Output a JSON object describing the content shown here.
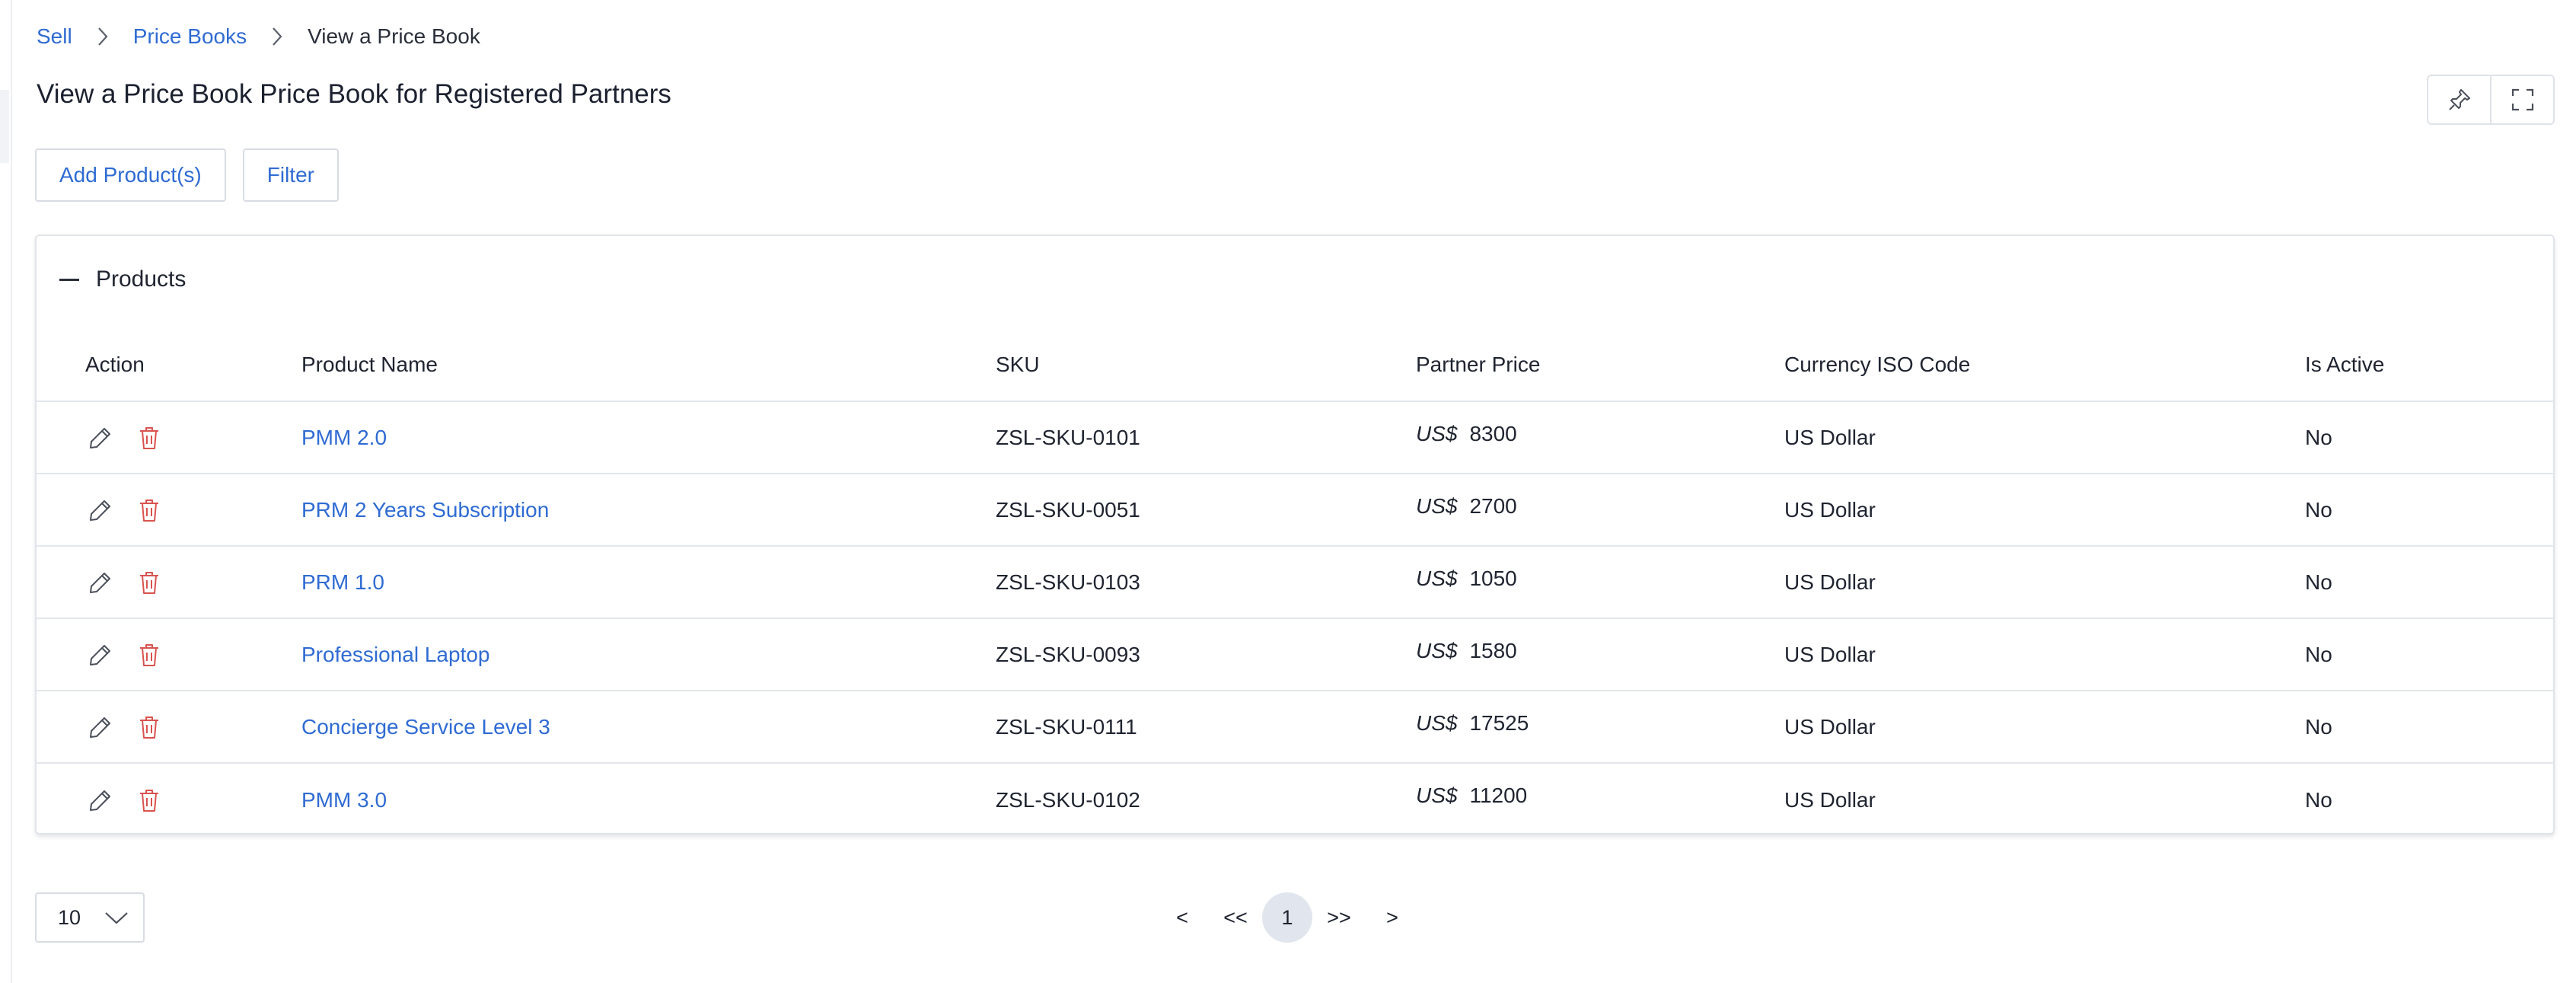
{
  "breadcrumb": {
    "items": [
      "Sell",
      "Price Books"
    ],
    "current": "View a Price Book"
  },
  "page": {
    "title": "View a Price Book Price Book for Registered Partners"
  },
  "header_actions": {
    "pin_icon": "pin-icon",
    "fullscreen_icon": "expand-icon"
  },
  "toolbar": {
    "add_products_label": "Add Product(s)",
    "filter_label": "Filter"
  },
  "products_panel": {
    "title": "Products",
    "columns": [
      "Action",
      "Product Name",
      "SKU",
      "Partner Price",
      "Currency ISO Code",
      "Is Active"
    ],
    "rows": [
      {
        "name": "PMM 2.0",
        "sku": "ZSL-SKU-0101",
        "currency_symbol": "US$",
        "price": "8300",
        "currency": "US Dollar",
        "active": "No"
      },
      {
        "name": "PRM 2 Years Subscription",
        "sku": "ZSL-SKU-0051",
        "currency_symbol": "US$",
        "price": "2700",
        "currency": "US Dollar",
        "active": "No"
      },
      {
        "name": "PRM 1.0",
        "sku": "ZSL-SKU-0103",
        "currency_symbol": "US$",
        "price": "1050",
        "currency": "US Dollar",
        "active": "No"
      },
      {
        "name": "Professional Laptop",
        "sku": "ZSL-SKU-0093",
        "currency_symbol": "US$",
        "price": "1580",
        "currency": "US Dollar",
        "active": "No"
      },
      {
        "name": "Concierge Service Level 3",
        "sku": "ZSL-SKU-0111",
        "currency_symbol": "US$",
        "price": "17525",
        "currency": "US Dollar",
        "active": "No"
      },
      {
        "name": "PMM 3.0",
        "sku": "ZSL-SKU-0102",
        "currency_symbol": "US$",
        "price": "11200",
        "currency": "US Dollar",
        "active": "No"
      }
    ]
  },
  "pagination": {
    "page_size": "10",
    "prev": "<",
    "first": "<<",
    "current_page": "1",
    "last": ">>",
    "next": ">"
  },
  "colors": {
    "link": "#2f6bd3",
    "delete_icon": "#d9534f",
    "edit_icon": "#4a4f5a",
    "current_page_bg": "#e1e6ee"
  }
}
